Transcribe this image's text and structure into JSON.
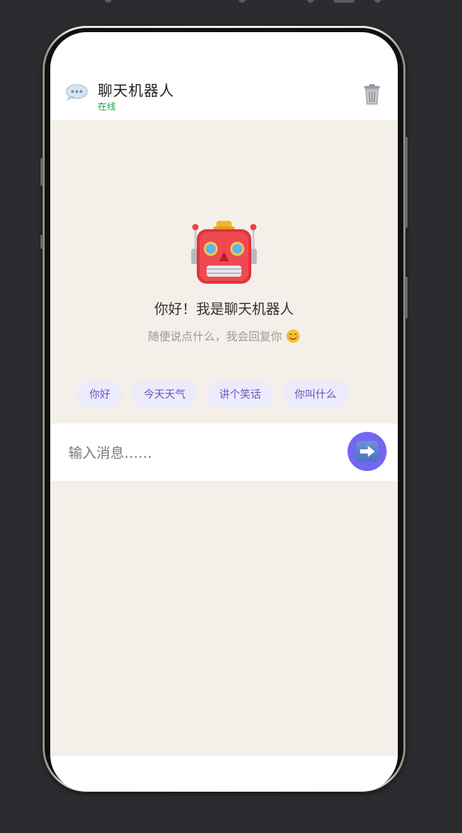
{
  "header": {
    "title": "聊天机器人",
    "status": "在线"
  },
  "welcome": {
    "greeting": "你好！我是聊天机器人",
    "subtitle": "随便说点什么，我会回复你"
  },
  "quick_replies": [
    {
      "label": "你好"
    },
    {
      "label": "今天天气"
    },
    {
      "label": "讲个笑话"
    },
    {
      "label": "你叫什么"
    }
  ],
  "composer": {
    "placeholder": "输入消息……",
    "value": ""
  },
  "colors": {
    "accent": "#7367f0",
    "online": "#1fa34a",
    "chip_bg": "#ecebfa",
    "chip_text": "#6654c6",
    "content_bg": "#f4efe9"
  },
  "icons": {
    "header_left": "speech-bubble-icon",
    "header_right": "trash-icon",
    "welcome": "robot-icon",
    "subtitle_emoji": "smile-icon",
    "send": "right-arrow-icon"
  }
}
